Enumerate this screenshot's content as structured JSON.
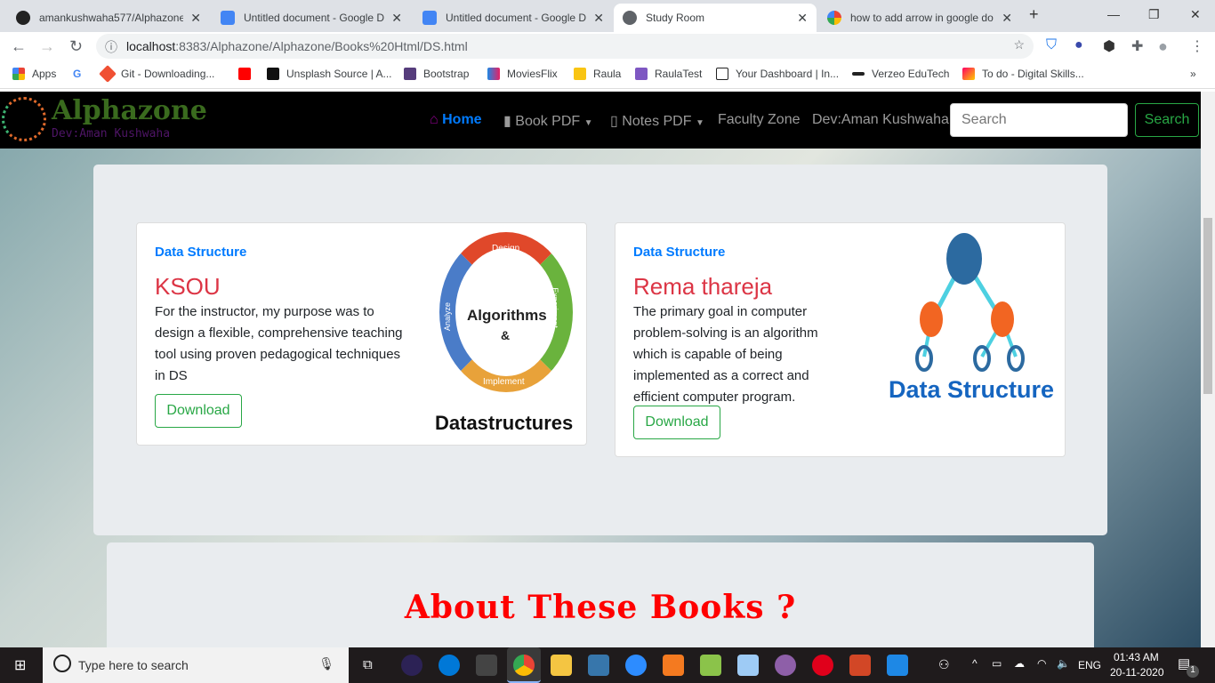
{
  "browser": {
    "tabs": [
      {
        "title": "amankushwaha577/Alphazone",
        "icon": "github-icon"
      },
      {
        "title": "Untitled document - Google Do",
        "icon": "google-docs-icon"
      },
      {
        "title": "Untitled document - Google Do",
        "icon": "google-docs-icon"
      },
      {
        "title": "Study Room",
        "icon": "globe-icon",
        "active": true
      },
      {
        "title": "how to add arrow in google do",
        "icon": "google-icon"
      }
    ],
    "url_host": "localhost",
    "url_rest": ":8383/Alphazone/Alphazone/Books%20Html/DS.html",
    "bookmarks": [
      "Apps",
      "",
      "Git - Downloading...",
      "",
      "Unsplash Source | A...",
      "Bootstrap",
      "MoviesFlix",
      "Raula",
      "RaulaTest",
      "Your Dashboard | In...",
      "Verzeo EduTech",
      "To do - Digital Skills..."
    ]
  },
  "navbar": {
    "brand": "Alphazone",
    "brand_sub": "Dev:Aman Kushwaha",
    "links": [
      "Home",
      "Book PDF",
      "Notes PDF",
      "Faculty Zone",
      "Dev:Aman Kushwaha"
    ],
    "search_placeholder": "Search",
    "search_button": "Search"
  },
  "cards": [
    {
      "category": "Data Structure",
      "title": "KSOU",
      "description": "For the instructor, my purpose was to design a flexible, comprehensive teaching tool using proven pedagogical techniques in DS",
      "button": "Download",
      "image_labels": {
        "center1": "Algorithms",
        "center2": "&",
        "design": "Design",
        "experiment": "Experiment",
        "implement": "Implement",
        "analyze": "Analyze",
        "caption": "Datastructures"
      }
    },
    {
      "category": "Data Structure",
      "title": "Rema thareja",
      "description": "The primary goal in computer problem-solving is an algorithm which is capable of being implemented as a correct and efficient computer program.",
      "button": "Download",
      "image_labels": {
        "caption": "Data Structure"
      }
    }
  ],
  "about": {
    "heading": "About These Books ?"
  },
  "taskbar": {
    "search_placeholder": "Type here to search",
    "lang": "ENG",
    "time": "01:43 AM",
    "date": "20-11-2020",
    "notifications": "1"
  }
}
